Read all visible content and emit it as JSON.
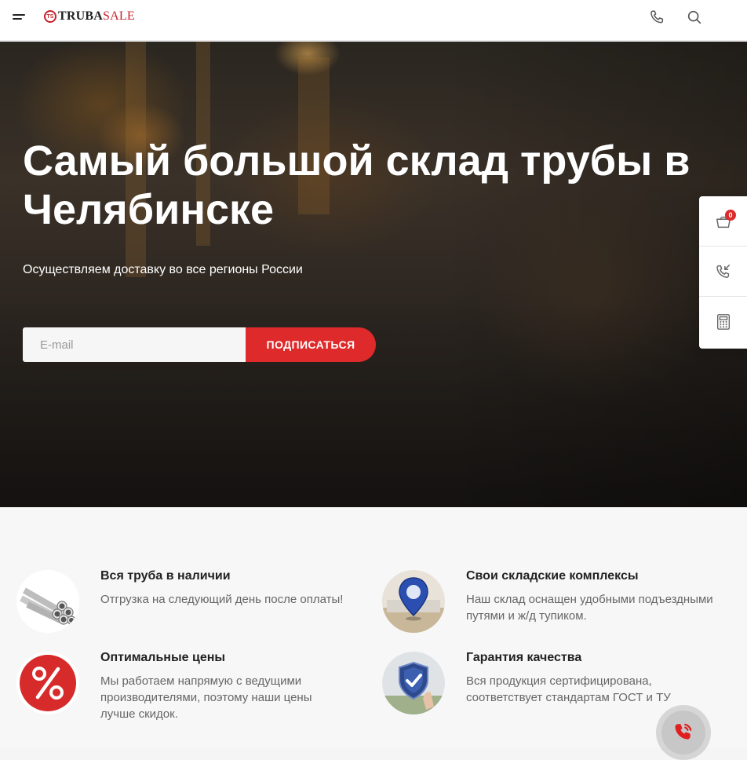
{
  "header": {
    "logo_mark": "TS",
    "logo_part1": "TRUBA",
    "logo_part2": "SALE"
  },
  "hero": {
    "title": "Самый большой склад трубы в Челябинске",
    "subtitle": "Осуществляем доставку во все регионы России",
    "email_placeholder": "E-mail",
    "email_value": "",
    "subscribe_label": "ПОДПИСАТЬСЯ"
  },
  "side_panel": {
    "cart_count": "0",
    "items": [
      {
        "icon": "cart-icon"
      },
      {
        "icon": "callback-icon"
      },
      {
        "icon": "calculator-icon"
      }
    ]
  },
  "features": [
    {
      "title": "Вся труба в наличии",
      "text": "Отгрузка на следующий день после оплаты!",
      "icon": "pipes-image"
    },
    {
      "title": "Свои складские комплексы",
      "text": "Наш склад оснащен удобными подъездными путями и ж/д тупиком.",
      "icon": "warehouse-pin-image"
    },
    {
      "title": "Оптимальные цены",
      "text": "Мы работаем напрямую с ведущими производителями, поэтому наши цены лучше скидок.",
      "icon": "percent-icon"
    },
    {
      "title": "Гарантия качества",
      "text": "Вся продукция сертифицирована, соответствует стандартам ГОСТ и ТУ",
      "icon": "quality-shield-image"
    }
  ],
  "colors": {
    "accent": "#de2a2a",
    "header_bg": "#ffffff",
    "features_bg": "#f7f7f7"
  }
}
